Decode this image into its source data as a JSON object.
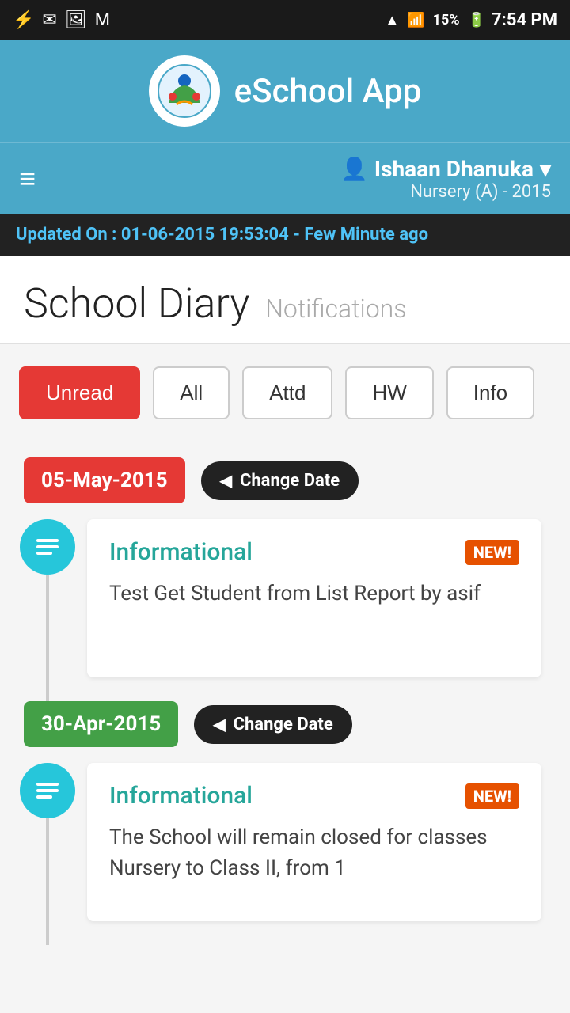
{
  "statusBar": {
    "time": "7:54 PM",
    "battery": "15%",
    "icons": [
      "usb",
      "mail",
      "image",
      "gmail",
      "wifi",
      "signal"
    ]
  },
  "appHeader": {
    "logo": "🎓",
    "title": "eSchool App"
  },
  "navBar": {
    "userName": "Ishaan Dhanuka",
    "userClass": "Nursery (A) - 2015",
    "dropdownIcon": "▾"
  },
  "updateBanner": {
    "label": "Updated On :",
    "datetime": "01-06-2015 19:53:04",
    "ago": "- Few Minute ago"
  },
  "pageHeader": {
    "title": "School Diary",
    "subtitle": "Notifications"
  },
  "filterTabs": {
    "tabs": [
      {
        "label": "Unread",
        "active": true
      },
      {
        "label": "All",
        "active": false
      },
      {
        "label": "Attd",
        "active": false
      },
      {
        "label": "HW",
        "active": false
      },
      {
        "label": "Info",
        "active": false
      }
    ]
  },
  "diaryItems": [
    {
      "date": "05-May-2015",
      "dateColor": "red",
      "changeDateLabel": "Change Date",
      "entries": [
        {
          "type": "Informational",
          "isNew": true,
          "newLabel": "NEW!",
          "content": "Test Get Student from List Report by asif"
        }
      ]
    },
    {
      "date": "30-Apr-2015",
      "dateColor": "green",
      "changeDateLabel": "Change Date",
      "entries": [
        {
          "type": "Informational",
          "isNew": true,
          "newLabel": "NEW!",
          "content": "The School will remain closed for classes Nursery to Class II, from 1"
        }
      ]
    }
  ]
}
